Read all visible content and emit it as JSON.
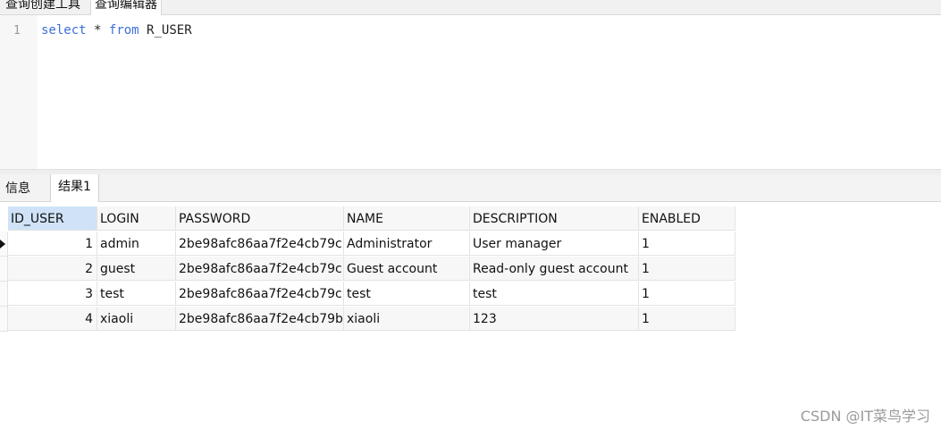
{
  "top_tabs": [
    "查询创建工具",
    "查询编辑器"
  ],
  "editor": {
    "line_number": "1",
    "keyword_select": "select",
    "star": "*",
    "keyword_from": "from",
    "table": "R_USER"
  },
  "result_tabs": [
    "信息",
    "结果1"
  ],
  "grid": {
    "columns": [
      "ID_USER",
      "LOGIN",
      "PASSWORD",
      "NAME",
      "DESCRIPTION",
      "ENABLED"
    ],
    "rows": [
      [
        "1",
        "admin",
        "2be98afc86aa7f2e4cb79c",
        "Administrator",
        "User manager",
        "1"
      ],
      [
        "2",
        "guest",
        "2be98afc86aa7f2e4cb79c",
        "Guest account",
        "Read-only guest account",
        "1"
      ],
      [
        "3",
        "test",
        "2be98afc86aa7f2e4cb79c",
        "test",
        "test",
        "1"
      ],
      [
        "4",
        "xiaoli",
        "2be98afc86aa7f2e4cb79b",
        "xiaoli",
        "123",
        "1"
      ]
    ]
  },
  "watermark": "CSDN @IT菜鸟学习",
  "colors": {
    "keyword": "#3b6fd8",
    "header_active": "#cfe2f7"
  }
}
